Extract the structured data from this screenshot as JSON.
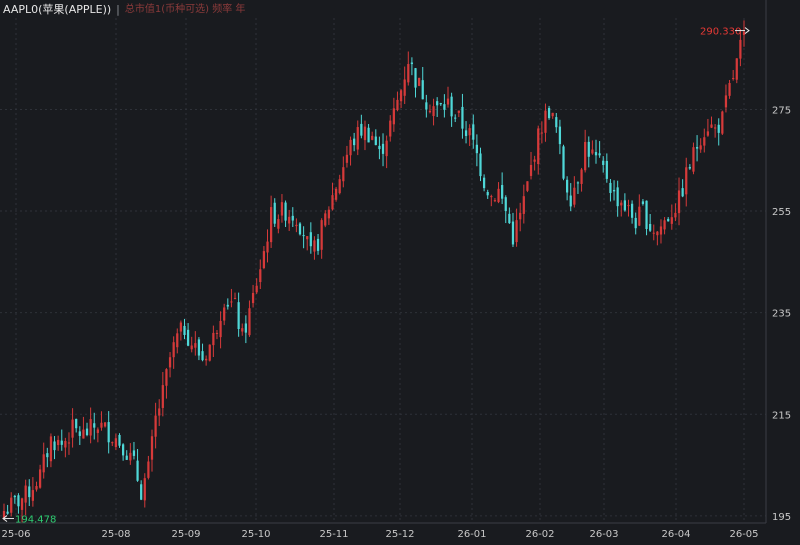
{
  "header": {
    "symbol": "AAPL0(苹果(APPLE))",
    "separator": "|",
    "indicator": "总市值1(币种可选) 频率 年"
  },
  "colors": {
    "background": "#191b1f",
    "up": "#d63a3a",
    "down": "#4fd8d8",
    "max_label": "#e53935",
    "min_label": "#2ecc71"
  },
  "chart_data": {
    "type": "candlestick",
    "y_ticks": [
      "195",
      "215",
      "235",
      "255",
      "275"
    ],
    "y_tick_values": [
      195,
      215,
      235,
      255,
      275
    ],
    "x_ticks": [
      "25-06",
      "25-08",
      "25-09",
      "25-10",
      "25-11",
      "25-12",
      "26-01",
      "26-02",
      "26-03",
      "26-04",
      "26-05"
    ],
    "ylim": [
      193.6,
      293.0
    ],
    "grid": true,
    "max_label": "290.330",
    "min_label": "194.478",
    "max_value": 290.33,
    "min_value": 194.478,
    "close_path": [
      [
        0,
        196
      ],
      [
        6,
        199
      ],
      [
        10,
        203
      ],
      [
        13,
        210
      ],
      [
        16,
        209
      ],
      [
        19,
        212
      ],
      [
        22,
        211
      ],
      [
        26,
        213
      ],
      [
        30,
        211
      ],
      [
        33,
        209
      ],
      [
        36,
        205
      ],
      [
        38,
        200
      ],
      [
        40,
        204
      ],
      [
        42,
        214
      ],
      [
        44,
        219
      ],
      [
        46,
        226
      ],
      [
        48,
        230
      ],
      [
        50,
        232
      ],
      [
        52,
        229
      ],
      [
        55,
        226
      ],
      [
        58,
        230
      ],
      [
        61,
        238
      ],
      [
        64,
        236
      ],
      [
        66,
        230
      ],
      [
        68,
        235
      ],
      [
        70,
        241
      ],
      [
        72,
        247
      ],
      [
        74,
        254
      ],
      [
        78,
        255
      ],
      [
        81,
        254
      ],
      [
        83,
        251
      ],
      [
        85,
        246
      ],
      [
        87,
        249
      ],
      [
        90,
        256
      ],
      [
        93,
        262
      ],
      [
        96,
        268
      ],
      [
        99,
        271
      ],
      [
        102,
        270
      ],
      [
        104,
        266
      ],
      [
        106,
        270
      ],
      [
        108,
        274
      ],
      [
        110,
        279
      ],
      [
        112,
        285
      ],
      [
        114,
        281
      ],
      [
        117,
        277
      ],
      [
        120,
        275
      ],
      [
        123,
        276
      ],
      [
        126,
        273
      ],
      [
        129,
        270
      ],
      [
        131,
        266
      ],
      [
        133,
        261
      ],
      [
        135,
        258
      ],
      [
        137,
        259
      ],
      [
        139,
        255
      ],
      [
        141,
        250
      ],
      [
        143,
        254
      ],
      [
        145,
        260
      ],
      [
        147,
        267
      ],
      [
        149,
        272
      ],
      [
        151,
        275
      ],
      [
        153,
        271
      ],
      [
        155,
        262
      ],
      [
        157,
        258
      ],
      [
        159,
        262
      ],
      [
        161,
        268
      ],
      [
        163,
        266
      ],
      [
        165,
        264
      ],
      [
        167,
        262
      ],
      [
        169,
        258
      ],
      [
        171,
        257
      ],
      [
        173,
        255
      ],
      [
        175,
        253
      ],
      [
        177,
        255
      ],
      [
        179,
        252
      ],
      [
        181,
        251
      ],
      [
        183,
        253
      ],
      [
        185,
        255
      ],
      [
        187,
        257
      ],
      [
        189,
        262
      ],
      [
        191,
        266
      ],
      [
        193,
        270
      ],
      [
        195,
        272
      ],
      [
        197,
        271
      ],
      [
        199,
        273
      ],
      [
        201,
        279
      ],
      [
        203,
        284
      ],
      [
        205,
        290.33
      ]
    ]
  }
}
